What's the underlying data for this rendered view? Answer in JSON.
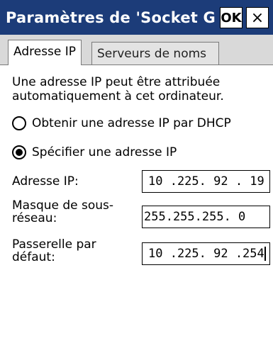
{
  "window": {
    "title": "Paramètres de 'Socket G...",
    "ok_label": "OK",
    "close_label": "×"
  },
  "tabs": [
    {
      "label": "Adresse IP",
      "active": true
    },
    {
      "label": "Serveurs de noms",
      "active": false
    }
  ],
  "panel": {
    "description": "Une adresse IP peut être attribuée automatiquement à cet ordinateur.",
    "radio_dhcp": {
      "label": "Obtenir une adresse IP par DHCP",
      "checked": false
    },
    "radio_static": {
      "label": "Spécifier une adresse IP",
      "checked": true
    },
    "fields": {
      "ip": {
        "label": "Adresse IP:",
        "value": "10 .225. 92 . 19"
      },
      "mask": {
        "label": "Masque de sous-réseau:",
        "value": "255.255.255. 0"
      },
      "gateway": {
        "label": "Passerelle par défaut:",
        "value": "10 .225. 92 .254"
      }
    }
  }
}
